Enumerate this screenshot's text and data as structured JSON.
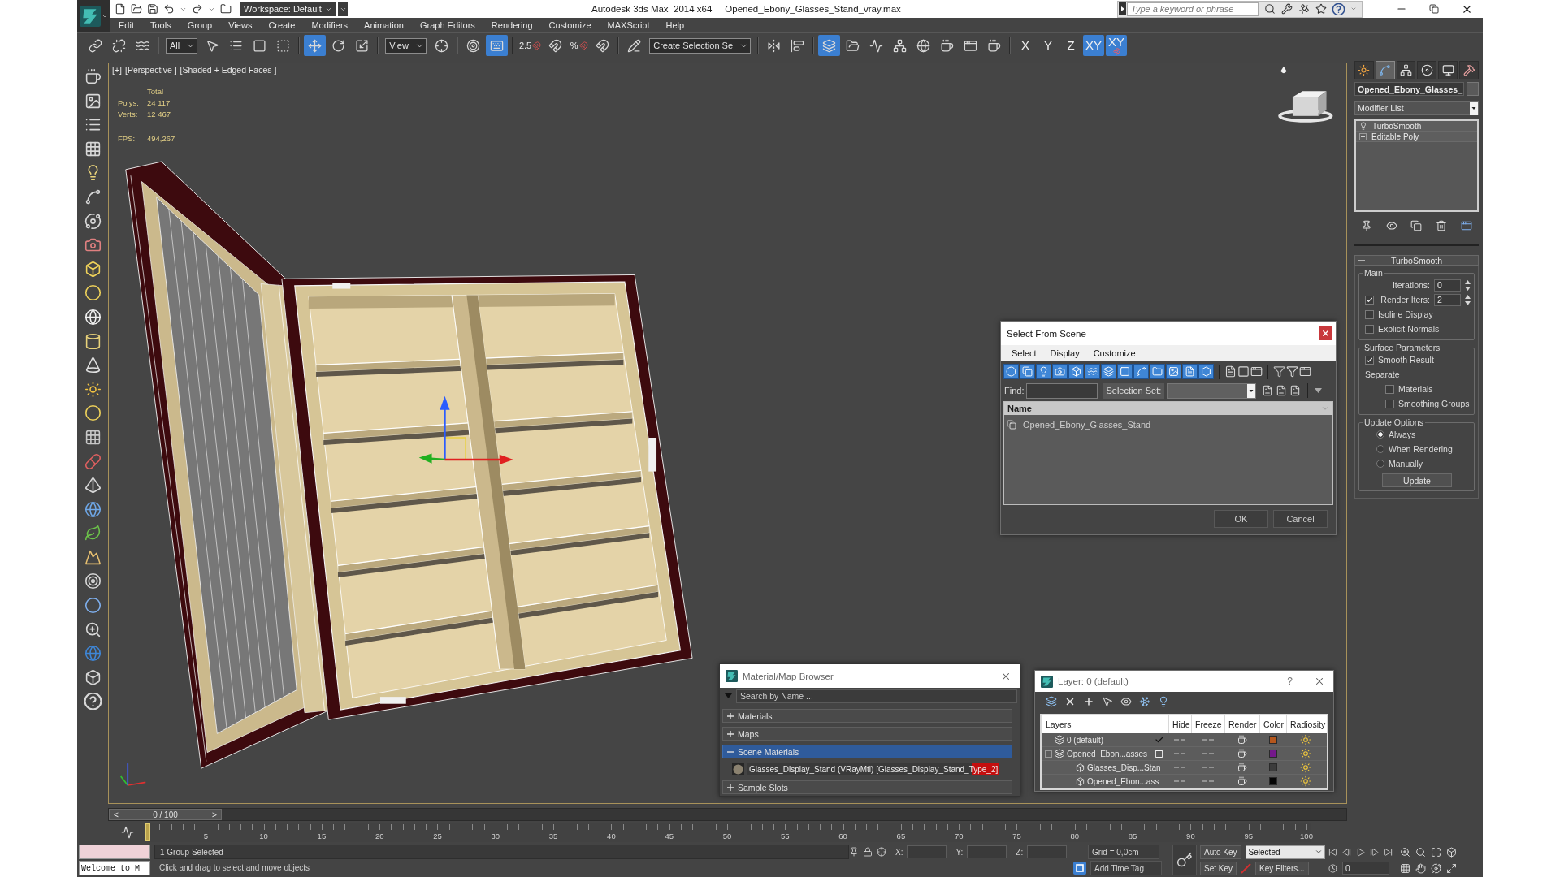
{
  "title_bar": {
    "workspace": "Workspace: Default",
    "app_title": "Autodesk 3ds Max  2014 x64",
    "file_name": "Opened_Ebony_Glasses_Stand_vray.max",
    "search": {
      "placeholder": "Type a keyword or phrase"
    }
  },
  "menu": [
    "Edit",
    "Tools",
    "Group",
    "Views",
    "Create",
    "Modifiers",
    "Animation",
    "Graph Editors",
    "Rendering",
    "Customize",
    "MAXScript",
    "Help"
  ],
  "main_toolbar": [
    [
      {
        "kind": "link",
        "selected": false
      },
      {
        "kind": "unlink",
        "selected": false
      },
      {
        "kind": "bind",
        "selected": false
      }
    ],
    [
      {
        "kind": "filterlist",
        "value": "All"
      },
      {
        "kind": "select",
        "selected": false
      },
      {
        "kind": "byname",
        "selected": false
      },
      {
        "kind": "region",
        "selected": false
      },
      {
        "kind": "crossing",
        "selected": false
      }
    ],
    [
      {
        "kind": "move",
        "selected": true
      },
      {
        "kind": "rotate",
        "selected": false
      },
      {
        "kind": "scale",
        "selected": false
      }
    ],
    [
      {
        "kind": "coordlist",
        "value": "View"
      },
      {
        "kind": "pivot",
        "selected": false
      }
    ],
    [
      {
        "kind": "manipulate",
        "selected": false
      },
      {
        "kind": "keyboard",
        "selected": true
      }
    ],
    [
      {
        "kind": "snap",
        "label": "2.5",
        "selected": false
      },
      {
        "kind": "angle",
        "selected": false
      },
      {
        "kind": "percent",
        "label": "%",
        "selected": false
      },
      {
        "kind": "spinner",
        "selected": false
      }
    ],
    [
      {
        "kind": "named",
        "selected": false
      },
      {
        "kind": "setlist",
        "value": "Create Selection Se"
      }
    ],
    [
      {
        "kind": "mirror",
        "selected": false
      },
      {
        "kind": "align",
        "selected": false
      }
    ],
    [
      {
        "kind": "scene",
        "selected": true
      },
      {
        "kind": "layer",
        "selected": false
      },
      {
        "kind": "curve",
        "selected": false
      },
      {
        "kind": "schematic",
        "selected": false
      },
      {
        "kind": "material",
        "selected": false
      },
      {
        "kind": "setup",
        "selected": false
      },
      {
        "kind": "frame",
        "selected": false
      },
      {
        "kind": "render",
        "selected": false
      }
    ],
    [
      {
        "kind": "axis",
        "label": "X",
        "selected": false
      },
      {
        "kind": "axis",
        "label": "Y",
        "selected": false
      },
      {
        "kind": "axis",
        "label": "Z",
        "selected": false
      },
      {
        "kind": "axis",
        "label": "XY",
        "selected": true
      },
      {
        "kind": "planesnap",
        "label": "XY",
        "selected": true
      }
    ]
  ],
  "viewport": {
    "labels": [
      "[+]",
      "[Perspective ]",
      "[Shaded + Edged Faces ]"
    ],
    "stats": {
      "heading": "Total",
      "rows": [
        {
          "label": "Polys:",
          "value": "24 117"
        },
        {
          "label": "Verts:",
          "value": "12 467"
        }
      ],
      "fps": {
        "label": "FPS:",
        "value": "494,267"
      }
    }
  },
  "command_panel": {
    "tabs": [
      {
        "selected": false
      },
      {
        "selected": true
      },
      {
        "selected": false
      },
      {
        "selected": false
      },
      {
        "selected": false
      },
      {
        "selected": false
      }
    ],
    "object_name": "Opened_Ebony_Glasses_",
    "modifier_list": "Modifier List",
    "stack": [
      {
        "kind": "modifier",
        "label": "TurboSmooth"
      },
      {
        "kind": "base",
        "label": "Editable Poly"
      }
    ],
    "rollout": {
      "title": "TurboSmooth",
      "expanded": true,
      "groups": [
        {
          "title": "Main",
          "rows": [
            {
              "kind": "spinner",
              "label": "Iterations:",
              "value": "0"
            },
            {
              "kind": "spinner",
              "label": "Render Iters:",
              "value": "2",
              "checked": true
            },
            {
              "kind": "check",
              "label": "Isoline Display",
              "checked": false
            },
            {
              "kind": "check",
              "label": "Explicit Normals",
              "checked": false
            }
          ]
        },
        {
          "title": "Surface Parameters",
          "rows": [
            {
              "kind": "check",
              "label": "Smooth Result",
              "checked": true
            },
            {
              "kind": "text",
              "label": "Separate"
            },
            {
              "kind": "subcheck",
              "label": "Materials",
              "checked": false
            },
            {
              "kind": "subcheck",
              "label": "Smoothing Groups",
              "checked": false
            }
          ]
        },
        {
          "title": "Update Options",
          "rows": [
            {
              "kind": "radio",
              "label": "Always",
              "selected": true
            },
            {
              "kind": "radio",
              "label": "When Rendering",
              "selected": false
            },
            {
              "kind": "radio",
              "label": "Manually",
              "selected": false
            },
            {
              "kind": "button",
              "label": "Update"
            }
          ]
        }
      ]
    }
  },
  "select_from_scene": {
    "title": "Select From Scene",
    "menu": [
      "Select",
      "Display",
      "Customize"
    ],
    "filters": [
      {
        "selected": true
      },
      {
        "selected": true
      },
      {
        "selected": true
      },
      {
        "selected": true
      },
      {
        "selected": true
      },
      {
        "selected": true
      },
      {
        "selected": true
      },
      {
        "selected": true
      },
      {
        "selected": true
      },
      {
        "selected": true
      },
      {
        "selected": true
      },
      {
        "selected": true
      },
      {
        "selected": true
      }
    ],
    "find_label": "Find:",
    "selection_set_label": "Selection Set:",
    "columns": [
      "Name"
    ],
    "rows": [
      "Opened_Ebony_Glasses_Stand"
    ],
    "buttons": [
      "OK",
      "Cancel"
    ]
  },
  "material_browser": {
    "title": "Material/Map Browser",
    "search": {
      "placeholder": "Search by Name ..."
    },
    "groups": [
      {
        "label": "Materials",
        "expanded": false,
        "selected": false
      },
      {
        "label": "Maps",
        "expanded": false,
        "selected": false
      },
      {
        "label": "Scene Materials",
        "expanded": true,
        "selected": true,
        "items": [
          "Glasses_Display_Stand (VRayMtl) [Glasses_Display_Stand_Type_2]"
        ]
      },
      {
        "label": "Sample Slots",
        "expanded": false,
        "selected": false
      }
    ]
  },
  "layer_manager": {
    "title": "Layer: 0 (default)",
    "help": "?",
    "columns": [
      "Layers",
      "Hide",
      "Freeze",
      "Render",
      "Color",
      "Radiosity"
    ],
    "layers": [
      {
        "kind": "layer",
        "name": "0 (default)",
        "current": true,
        "color": "#b4561c"
      },
      {
        "kind": "layer",
        "name": "Opened_Ebon...asses_",
        "current": false,
        "color": "#74188a",
        "expanded": true,
        "children": [
          {
            "kind": "object",
            "name": "Glasses_Disp...Stan",
            "color": "#3c3c3c"
          },
          {
            "kind": "object",
            "name": "Opened_Ebon...ass",
            "color": "#050505"
          }
        ]
      }
    ]
  },
  "time_slider": {
    "prev": "<",
    "position": "0 / 100",
    "next": ">",
    "level": 0
  },
  "track_bar": {
    "ticks": [
      "5",
      "10",
      "15",
      "20",
      "25",
      "30",
      "35",
      "40",
      "45",
      "50",
      "55",
      "60",
      "65",
      "70",
      "75",
      "80",
      "85",
      "90",
      "95",
      "100"
    ]
  },
  "status_bar": {
    "listener": "Welcome to M",
    "selection": "1 Group Selected",
    "prompt": "Click and drag to select and move objects",
    "coords": [
      {
        "label": "X:"
      },
      {
        "label": "Y:"
      },
      {
        "label": "Z:"
      }
    ],
    "grid": "Grid = 0,0cm",
    "time_tag": "Add Time Tag",
    "auto_key": {
      "label": "Auto Key",
      "selected": false
    },
    "key_mode": "Selected",
    "set_key": "Set Key",
    "key_filters": "Key Filters...",
    "frame": "0"
  }
}
